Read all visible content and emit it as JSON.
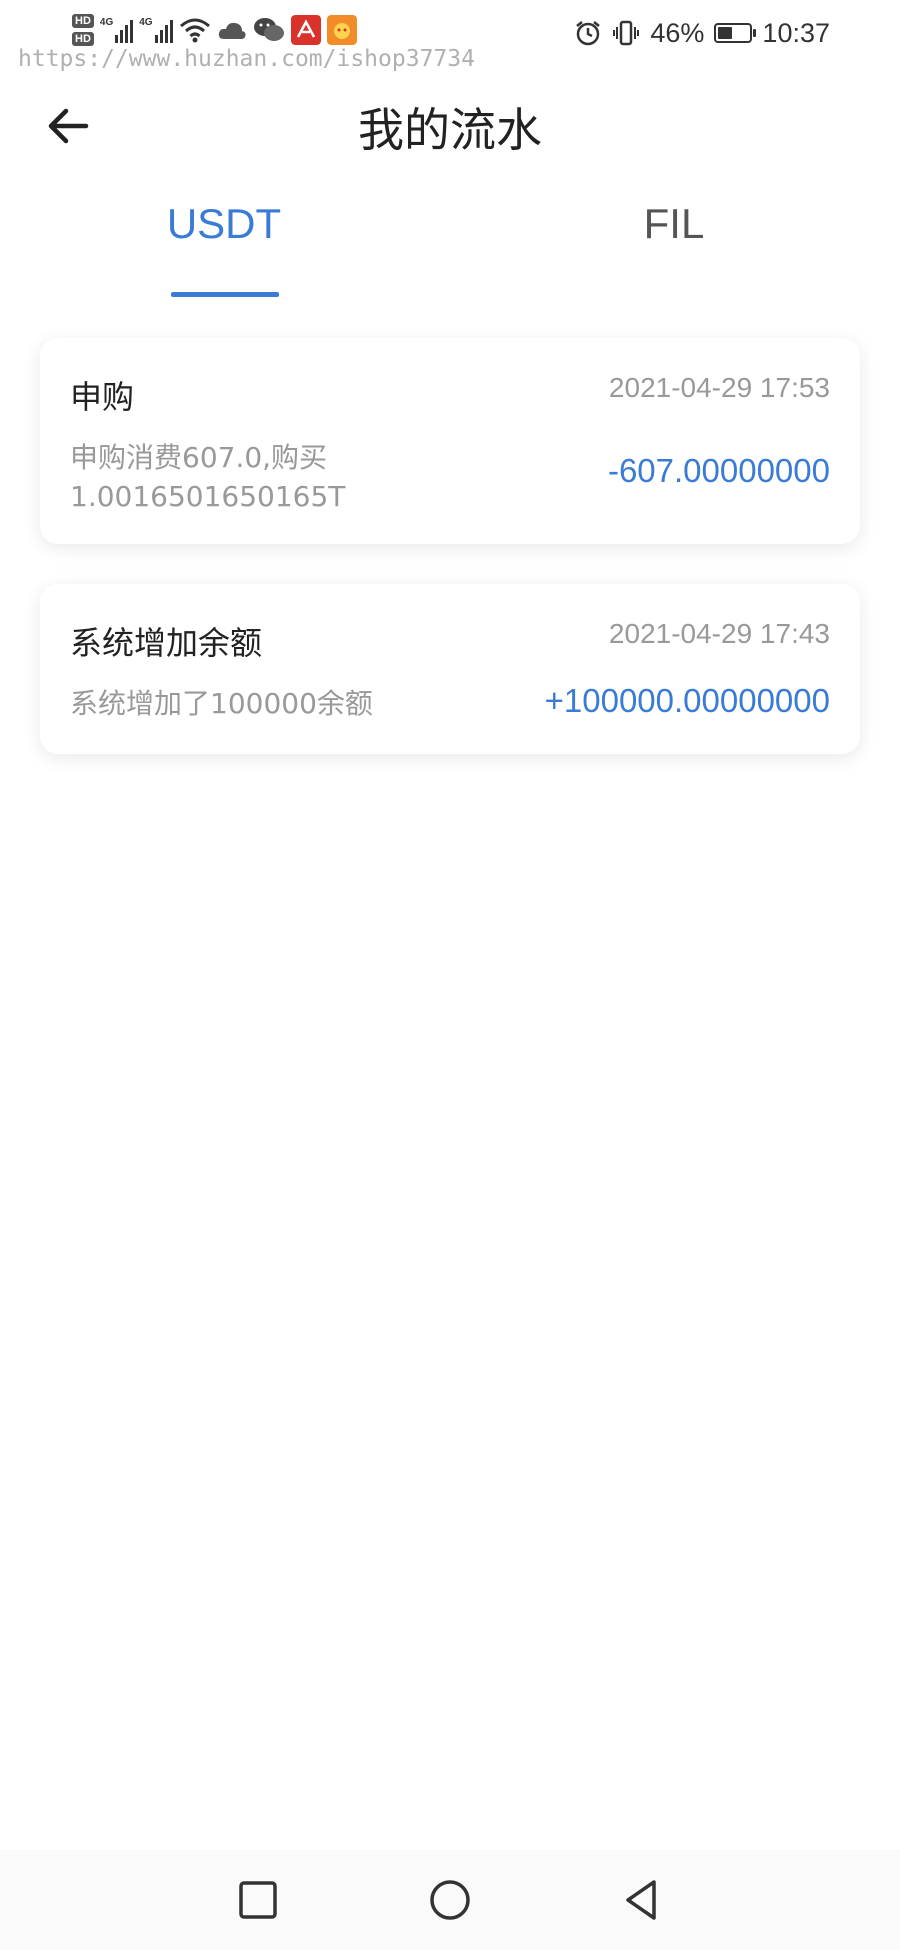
{
  "status_bar": {
    "hd1": "HD",
    "hd2": "HD",
    "net1": "4G",
    "net2": "4G",
    "battery_percent": "46%",
    "battery_level": 0.46,
    "time": "10:37",
    "icons": [
      "signal-icon",
      "wifi-icon",
      "cloud-icon",
      "wechat-icon",
      "app-red-icon",
      "app-orange-icon",
      "alarm-icon",
      "vibrate-icon",
      "battery-icon"
    ]
  },
  "watermark": "https://www.huzhan.com/ishop37734",
  "header": {
    "back_icon": "arrow-left-icon",
    "title": "我的流水"
  },
  "tabs": {
    "items": [
      {
        "label": "USDT",
        "active": true
      },
      {
        "label": "FIL",
        "active": false
      }
    ],
    "active_color": "#3a7bd5"
  },
  "records": [
    {
      "title": "申购",
      "time": "2021-04-29 17:53",
      "desc_line1": "申购消费607.0,购买",
      "desc_line2": "1.0016501650165T",
      "amount": "-607.00000000"
    },
    {
      "title": "系统增加余额",
      "time": "2021-04-29 17:43",
      "desc_line1": "系统增加了100000余额",
      "amount": "+100000.00000000"
    }
  ],
  "nav_bar": {
    "icons": [
      "recent-apps-icon",
      "home-icon",
      "back-triangle-icon"
    ]
  },
  "colors": {
    "accent": "#3a7bd5",
    "muted_text": "#999999",
    "primary_text": "#222222"
  }
}
